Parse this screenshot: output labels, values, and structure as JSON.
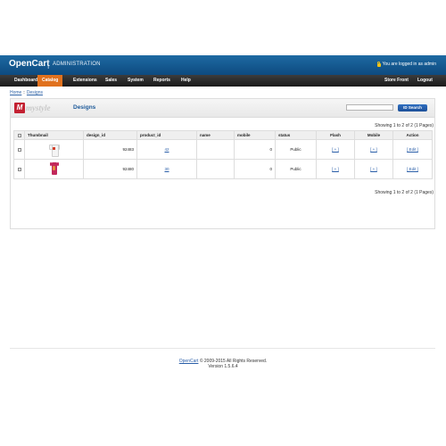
{
  "header": {
    "logo": "OpenCart",
    "separator": "|",
    "subtitle": "ADMINISTRATION",
    "login_text": "You are logged in as admin"
  },
  "menu": {
    "items": [
      {
        "label": "Dashboard",
        "active": false
      },
      {
        "label": "Catalog",
        "active": true
      },
      {
        "label": "Extensions",
        "active": false
      },
      {
        "label": "Sales",
        "active": false
      },
      {
        "label": "System",
        "active": false
      },
      {
        "label": "Reports",
        "active": false
      },
      {
        "label": "Help",
        "active": false
      }
    ],
    "right_items": [
      {
        "label": "Store Front"
      },
      {
        "label": "Logout"
      }
    ],
    "active_color": "#e0711e"
  },
  "breadcrumb": {
    "home": "Home",
    "separator": "::",
    "current": "Designs"
  },
  "page": {
    "brand_letter": "M",
    "brand_word": "mystyle",
    "title": "Designs",
    "search_value": "",
    "search_button": "ID Search",
    "pagination_top": "Showing 1 to 2 of 2 (1 Pages)",
    "pagination_bottom": "Showing 1 to 2 of 2 (1 Pages)"
  },
  "table": {
    "columns": [
      "Thumbnail",
      "design_id",
      "product_id",
      "name",
      "mobile",
      "status",
      "Flash",
      "Mobile",
      "Action"
    ],
    "rows": [
      {
        "thumbnail": "white-tshirt-thumbnail",
        "design_id": "92483",
        "product_id": "42",
        "name": "",
        "mobile": "0",
        "status": "Public",
        "flash": "[ + ]",
        "mobile_link": "[ + ]",
        "action": "[ Edit ]"
      },
      {
        "thumbnail": "pink-case-thumbnail",
        "design_id": "92480",
        "product_id": "30",
        "name": "",
        "mobile": "0",
        "status": "Public",
        "flash": "[ + ]",
        "mobile_link": "[ + ]",
        "action": "[ Edit ]"
      }
    ]
  },
  "footer": {
    "link": "OpenCart",
    "copyright": "© 2009-2015 All Rights Reserved.",
    "version": "Version 1.5.6.4"
  },
  "colors": {
    "header": "#1e6aa3",
    "link": "#2a5ea8",
    "search_button": "#2f6fc1",
    "heading": "#1e5a9a"
  }
}
